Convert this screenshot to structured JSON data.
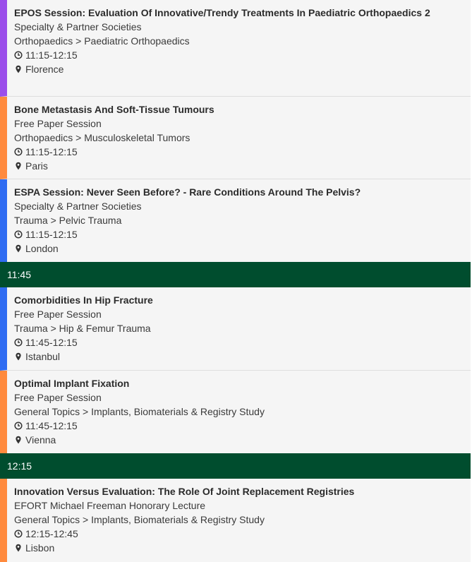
{
  "colors": {
    "purple": "#9b4dea",
    "orange": "#ff8a3d",
    "blue": "#2f6cf2",
    "separator": "#004d2e"
  },
  "sessions_group_1": [
    {
      "title": "EPOS Session: Evaluation Of Innovative/Trendy Treatments In Paediatric Orthopaedics 2",
      "type": "Specialty & Partner Societies",
      "category": "Orthopaedics > Paediatric Orthopaedics",
      "time": "11:15-12:15",
      "room": "Florence",
      "color": "purple"
    },
    {
      "title": "Bone Metastasis And Soft-Tissue Tumours",
      "type": "Free Paper Session",
      "category": "Orthopaedics > Musculoskeletal Tumors",
      "time": "11:15-12:15",
      "room": "Paris",
      "color": "orange"
    },
    {
      "title": "ESPA Session: Never Seen Before? - Rare Conditions Around The Pelvis?",
      "type": "Specialty & Partner Societies",
      "category": "Trauma > Pelvic Trauma",
      "time": "11:15-12:15",
      "room": "London",
      "color": "blue"
    }
  ],
  "separator_1": "11:45",
  "sessions_group_2": [
    {
      "title": "Comorbidities In Hip Fracture",
      "type": "Free Paper Session",
      "category": "Trauma > Hip & Femur Trauma",
      "time": "11:45-12:15",
      "room": "Istanbul",
      "color": "blue"
    },
    {
      "title": "Optimal Implant Fixation",
      "type": "Free Paper Session",
      "category": "General Topics > Implants, Biomaterials & Registry Study",
      "time": "11:45-12:15",
      "room": "Vienna",
      "color": "orange"
    }
  ],
  "separator_2": "12:15",
  "sessions_group_3": [
    {
      "title": "Innovation Versus Evaluation: The Role Of Joint Replacement Registries",
      "type": "EFORT Michael Freeman Honorary Lecture",
      "category": "General Topics > Implants, Biomaterials & Registry Study",
      "time": "12:15-12:45",
      "room": "Lisbon",
      "color": "orange"
    }
  ]
}
